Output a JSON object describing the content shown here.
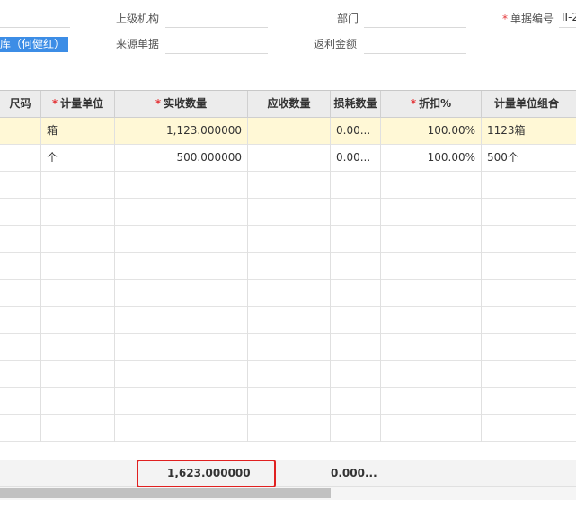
{
  "form": {
    "parent_org_label": "上级机构",
    "department_label": "部门",
    "doc_no_label": "单据编号",
    "doc_no_value": "II-2",
    "source_doc_label": "来源单据",
    "rebate_amount_label": "返利金额",
    "warehouse_value": "库（何健红）"
  },
  "grid": {
    "columns": [
      {
        "label": "尺码",
        "required": false
      },
      {
        "label": "计量单位",
        "required": true
      },
      {
        "label": "实收数量",
        "required": true
      },
      {
        "label": "应收数量",
        "required": false
      },
      {
        "label": "损耗数量",
        "required": false
      },
      {
        "label": "折扣%",
        "required": true
      },
      {
        "label": "计量单位组合",
        "required": false
      }
    ],
    "rows": [
      {
        "size": "",
        "unit": "箱",
        "received_qty": "1,123.000000",
        "expected_qty": "",
        "loss_qty": "0.00...",
        "discount": "100.00%",
        "unit_combo": "1123箱"
      },
      {
        "size": "",
        "unit": "个",
        "received_qty": "500.000000",
        "expected_qty": "",
        "loss_qty": "0.00...",
        "discount": "100.00%",
        "unit_combo": "500个"
      }
    ]
  },
  "totals": {
    "received_qty_total": "1,623.000000",
    "loss_qty_total": "0.000..."
  },
  "colors": {
    "required_marker": "#e4393c",
    "highlight_row": "#fff8d6",
    "selection": "#3c8de6",
    "annotation_box": "#e02020"
  }
}
